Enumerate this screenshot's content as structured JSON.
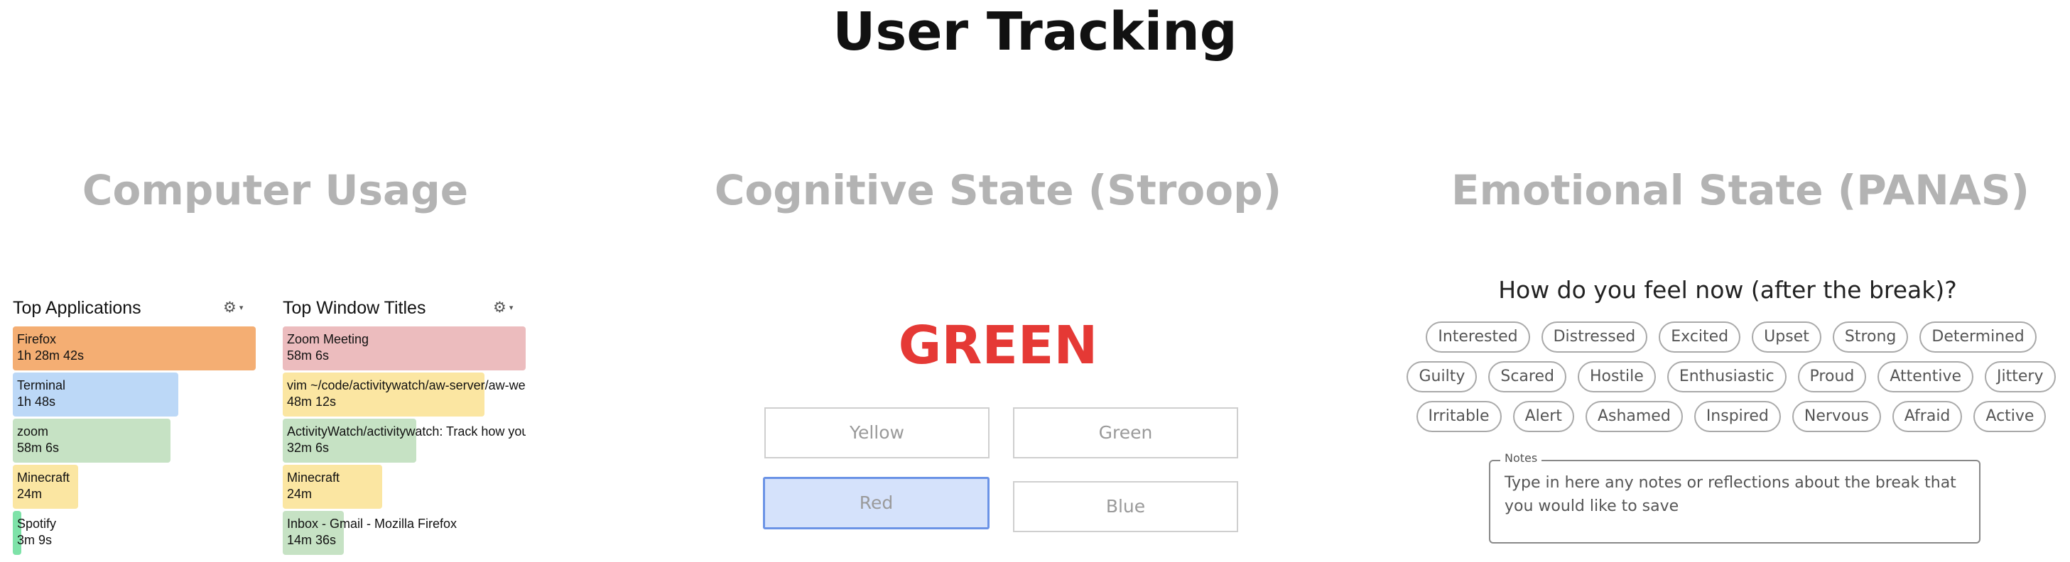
{
  "page": {
    "title": "User Tracking"
  },
  "sections": {
    "computer_usage": "Computer Usage",
    "cognitive": "Cognitive State (Stroop)",
    "emotional": "Emotional State (PANAS)"
  },
  "activitywatch": {
    "gear_icon": "gear-icon",
    "top_apps": {
      "title": "Top Applications",
      "items": [
        {
          "name": "Firefox",
          "duration": "1h 28m 42s",
          "fraction": 1.0,
          "color": "#f4ae73"
        },
        {
          "name": "Terminal",
          "duration": "1h 48s",
          "fraction": 0.68,
          "color": "#bcd8f7"
        },
        {
          "name": "zoom",
          "duration": "58m 6s",
          "fraction": 0.65,
          "color": "#c6e2c4"
        },
        {
          "name": "Minecraft",
          "duration": "24m",
          "fraction": 0.27,
          "color": "#fbe6a2"
        },
        {
          "name": "Spotify",
          "duration": "3m 9s",
          "fraction": 0.035,
          "color": "#7ee2a8"
        }
      ]
    },
    "top_titles": {
      "title": "Top Window Titles",
      "items": [
        {
          "name": "Zoom Meeting",
          "duration": "58m 6s",
          "fraction": 1.0,
          "color": "#ecbcbe"
        },
        {
          "name": "vim ~/code/activitywatch/aw-server/aw-webui",
          "duration": "48m 12s",
          "fraction": 0.83,
          "color": "#fbe6a2"
        },
        {
          "name": "ActivityWatch/activitywatch: Track how you spend your time",
          "duration": "32m 6s",
          "fraction": 0.55,
          "color": "#c6e2c4"
        },
        {
          "name": "Minecraft",
          "duration": "24m",
          "fraction": 0.41,
          "color": "#fbe6a2"
        },
        {
          "name": "Inbox - Gmail - Mozilla Firefox",
          "duration": "14m 36s",
          "fraction": 0.25,
          "color": "#c6e2c4"
        }
      ]
    }
  },
  "stroop": {
    "word": "GREEN",
    "word_color": "#e53935",
    "options": [
      "Yellow",
      "Green",
      "Red",
      "Blue"
    ],
    "selected": "Red"
  },
  "panas": {
    "question": "How do you feel now (after the break)?",
    "rows": [
      [
        "Interested",
        "Distressed",
        "Excited",
        "Upset",
        "Strong",
        "Determined"
      ],
      [
        "Guilty",
        "Scared",
        "Hostile",
        "Enthusiastic",
        "Proud",
        "Attentive",
        "Jittery"
      ],
      [
        "Irritable",
        "Alert",
        "Ashamed",
        "Inspired",
        "Nervous",
        "Afraid",
        "Active"
      ]
    ],
    "notes_label": "Notes",
    "notes_placeholder": "Type in here any notes or reflections about the break that you would like to save"
  }
}
